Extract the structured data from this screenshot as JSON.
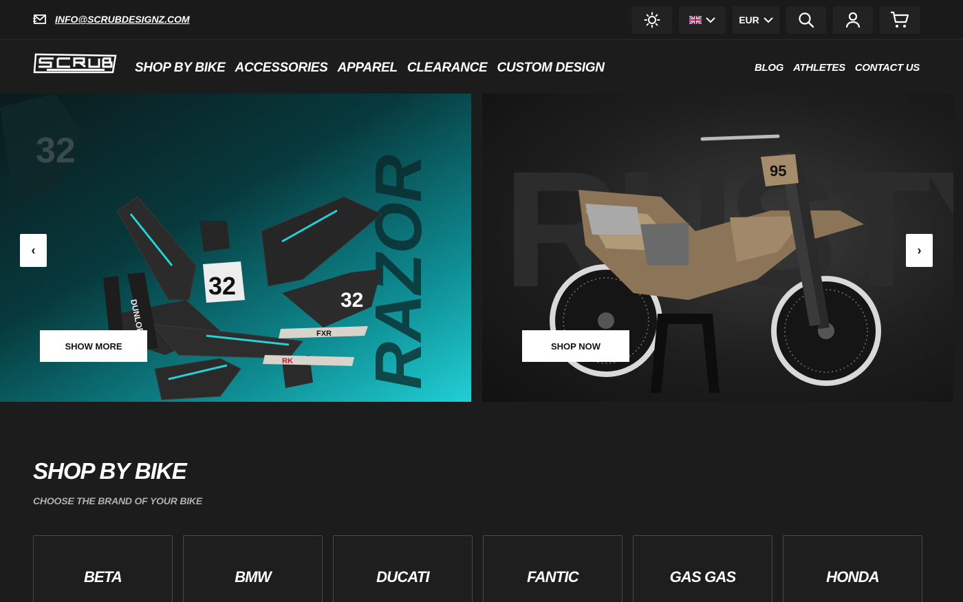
{
  "topbar": {
    "email": "INFO@SCRUBDESIGNZ.COM",
    "currency": "EUR",
    "icons": [
      "mail-icon",
      "sun-icon",
      "uk-flag-icon",
      "chevron-down-icon",
      "search-icon",
      "user-icon",
      "cart-icon"
    ]
  },
  "nav": {
    "main": [
      "SHOP BY BIKE",
      "ACCESSORIES",
      "APPAREL",
      "CLEARANCE",
      "CUSTOM DESIGN"
    ],
    "right": [
      "BLOG",
      "ATHLETES",
      "CONTACT US"
    ]
  },
  "hero": {
    "left": {
      "button": "SHOW MORE",
      "bg_text": "RAZOR",
      "numbers": [
        "32",
        "32",
        "32"
      ],
      "decal_brands": [
        "FXR",
        "DUNLOP",
        "RK",
        "SCRUB"
      ]
    },
    "right": {
      "button": "SHOP NOW",
      "bg_text": "RUSTY",
      "plate_number": "95"
    },
    "prev": "‹",
    "next": "›"
  },
  "section": {
    "title": "SHOP BY BIKE",
    "subtitle": "CHOOSE THE BRAND OF YOUR BIKE",
    "brands": [
      "BETA",
      "BMW",
      "DUCATI",
      "FANTIC",
      "GAS GAS",
      "HONDA"
    ]
  },
  "colors": {
    "background": "#1c1c1c",
    "accent_teal": "#21cfd5",
    "button_bg": "#ffffff"
  }
}
